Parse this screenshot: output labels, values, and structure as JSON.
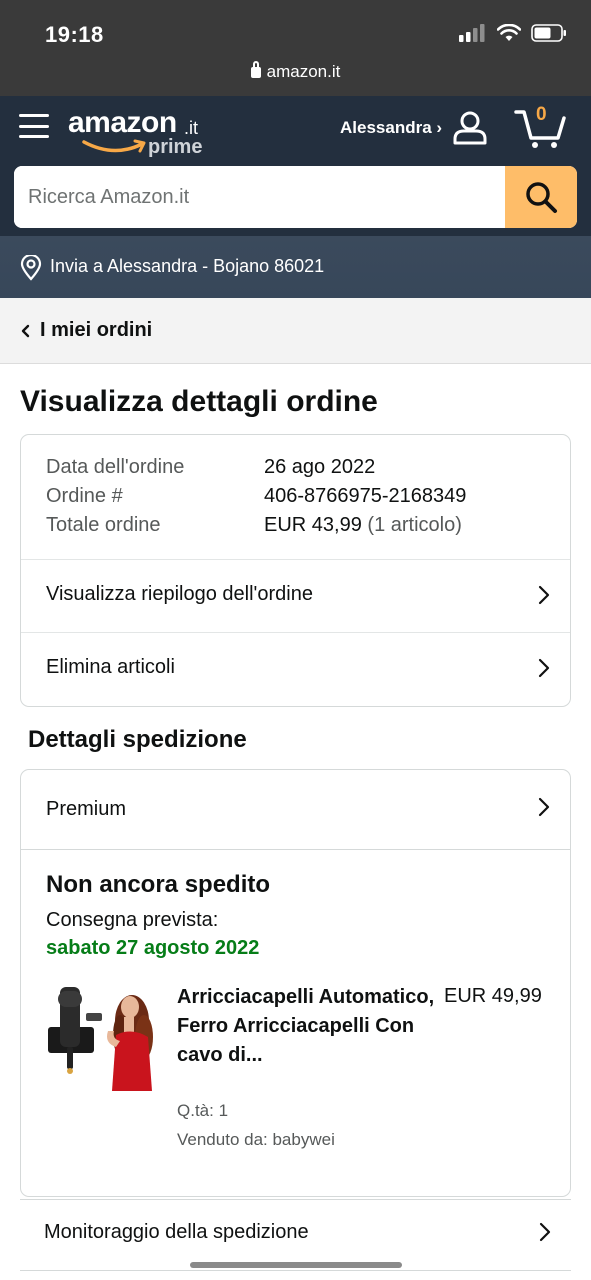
{
  "status_bar": {
    "time": "19:18",
    "url": "amazon.it"
  },
  "header": {
    "logo_text": "amazon",
    "logo_tld": ".it",
    "logo_sub": "prime",
    "account_label": "Alessandra ›",
    "cart_count": "0",
    "brand_color": "#232f3e",
    "accent_color": "#febd69"
  },
  "search": {
    "placeholder": "Ricerca Amazon.it"
  },
  "deliver": {
    "text": "Invia a Alessandra - Bojano 86021"
  },
  "breadcrumb": {
    "label": "I miei ordini"
  },
  "page": {
    "title": "Visualizza dettagli ordine"
  },
  "order_summary": {
    "date_label": "Data dell'ordine",
    "date_value": "26 ago 2022",
    "number_label": "Ordine #",
    "number_value": "406-8766975-2168349",
    "total_label": "Totale ordine",
    "total_value": "EUR 43,99",
    "total_items": "(1 articolo)",
    "link_summary": "Visualizza riepilogo dell'ordine",
    "link_delete": "Elimina articoli"
  },
  "shipping": {
    "section_title": "Dettagli spedizione",
    "method": "Premium",
    "status": "Non ancora spedito",
    "eta_label": "Consegna prevista:",
    "eta_date": "sabato 27 agosto 2022",
    "eta_color": "#067d18",
    "item": {
      "title": "Arricciacapelli Automatico, Ferro Arricciacapelli Con cavo di...",
      "price": "EUR 49,99",
      "quantity": "Q.tà: 1",
      "seller": "Venduto da: babywei"
    },
    "tracking_label": "Monitoraggio della spedizione"
  }
}
